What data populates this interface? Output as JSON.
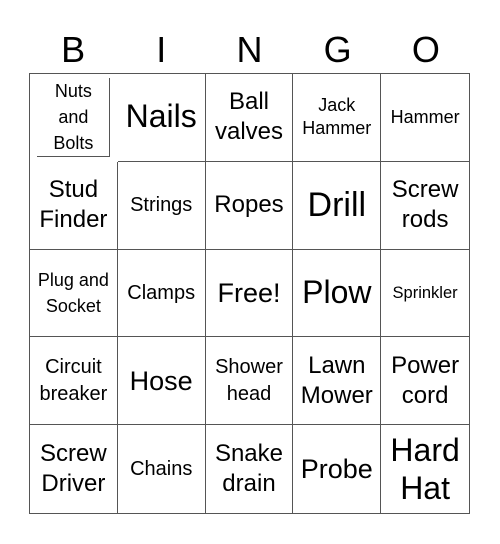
{
  "header": [
    "B",
    "I",
    "N",
    "G",
    "O"
  ],
  "cells": [
    "Nuts and Bolts",
    "Nails",
    "Ball valves",
    "Jack Hammer",
    "Hammer",
    "Stud Finder",
    "Strings",
    "Ropes",
    "Drill",
    "Screw rods",
    "Plug and Socket",
    "Clamps",
    "Free!",
    "Plow",
    "Sprinkler",
    "Circuit breaker",
    "Hose",
    "Shower head",
    "Lawn Mower",
    "Power cord",
    "Screw Driver",
    "Chains",
    "Snake drain",
    "Probe",
    "Hard Hat"
  ]
}
